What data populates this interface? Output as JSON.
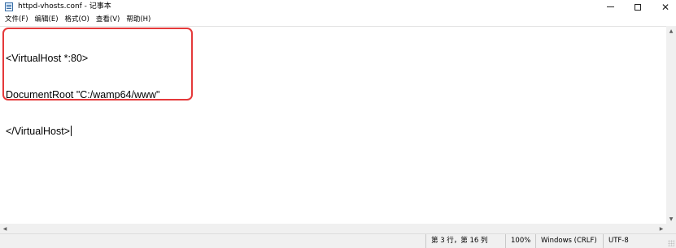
{
  "window": {
    "title": "httpd-vhosts.conf - 记事本",
    "icon": "notepad-icon",
    "controls": {
      "minimize_icon": "minimize-icon",
      "maximize_icon": "maximize-icon",
      "close_icon": "close-icon",
      "close_glyph": "✕"
    }
  },
  "menu": {
    "items": [
      {
        "label": "文件(F)"
      },
      {
        "label": "编辑(E)"
      },
      {
        "label": "格式(O)"
      },
      {
        "label": "查看(V)"
      },
      {
        "label": "帮助(H)"
      }
    ]
  },
  "editor": {
    "lines": [
      "<VirtualHost *:80>",
      "DocumentRoot \"C:/wamp64/www\"",
      "</VirtualHost>"
    ],
    "highlight_color": "#e5393a"
  },
  "scrollbars": {
    "up_arrow": "▲",
    "down_arrow": "▼",
    "left_arrow": "◀",
    "right_arrow": "▶"
  },
  "status": {
    "position": "第 3 行，第 16 列",
    "zoom": "100%",
    "line_ending": "Windows (CRLF)",
    "encoding": "UTF-8"
  }
}
